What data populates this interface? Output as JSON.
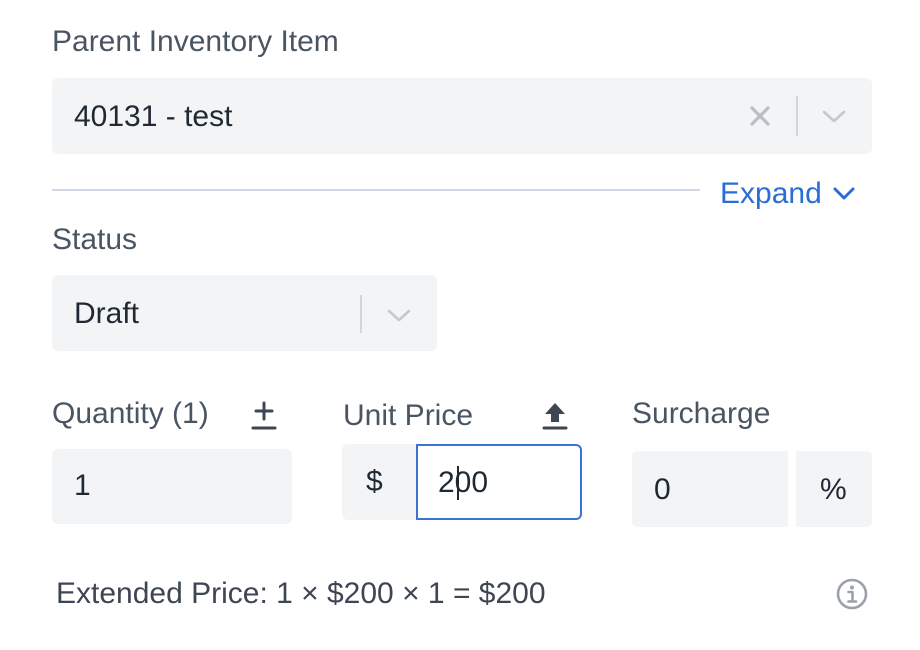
{
  "parent_item": {
    "label": "Parent Inventory Item",
    "value": "40131 - test",
    "clear_icon": "close-icon",
    "dropdown_icon": "chevron-down-icon"
  },
  "expand": {
    "label": "Expand",
    "icon": "chevron-down-icon"
  },
  "status": {
    "label": "Status",
    "value": "Draft",
    "dropdown_icon": "chevron-down-icon"
  },
  "quantity": {
    "label": "Quantity (1)",
    "value": "1",
    "icon": "plus-minus-icon"
  },
  "unit_price": {
    "label": "Unit Price",
    "prefix": "$",
    "value": "200",
    "icon": "upload-icon"
  },
  "surcharge": {
    "label": "Surcharge",
    "value": "0",
    "suffix": "%"
  },
  "extended_price": {
    "text": "Extended Price: 1 × $200 × 1 = $200",
    "icon": "info-icon"
  },
  "colors": {
    "accent": "#2b6cd6",
    "field_bg": "#f3f4f6",
    "label_text": "#4a5563",
    "focus_border": "#3b73d4"
  }
}
